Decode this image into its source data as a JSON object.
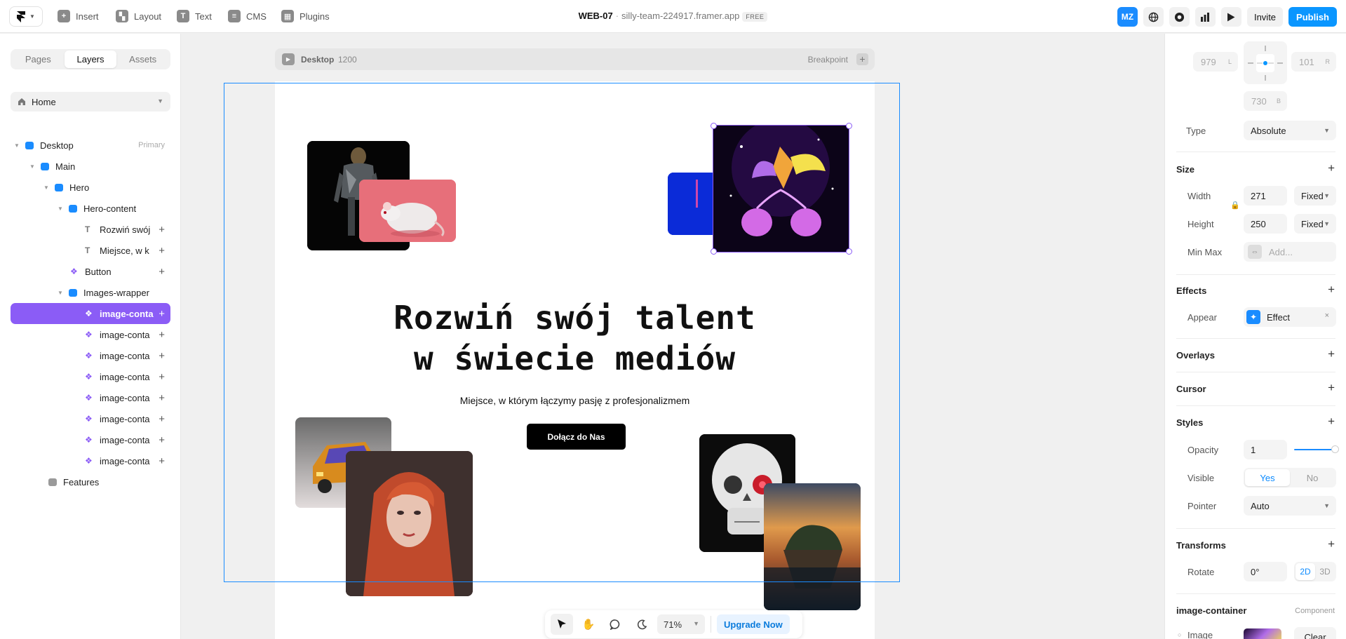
{
  "toolbar": {
    "insert": "Insert",
    "layout": "Layout",
    "text": "Text",
    "cms": "CMS",
    "plugins": "Plugins"
  },
  "project": {
    "name": "WEB-07",
    "separator": "·",
    "url": "silly-team-224917.framer.app",
    "plan": "FREE"
  },
  "topright": {
    "avatar": "MZ",
    "invite": "Invite",
    "publish": "Publish"
  },
  "left_panel": {
    "tabs": [
      "Pages",
      "Layers",
      "Assets"
    ],
    "active_tab": "Layers",
    "page": "Home",
    "layers": [
      {
        "label": "Desktop",
        "tag": "Primary"
      },
      {
        "label": "Main"
      },
      {
        "label": "Hero"
      },
      {
        "label": "Hero-content"
      },
      {
        "label": "Rozwiń swój"
      },
      {
        "label": "Miejsce, w k"
      },
      {
        "label": "Button"
      },
      {
        "label": "Images-wrapper"
      },
      {
        "label": "image-conta"
      },
      {
        "label": "image-conta"
      },
      {
        "label": "image-conta"
      },
      {
        "label": "image-conta"
      },
      {
        "label": "image-conta"
      },
      {
        "label": "image-conta"
      },
      {
        "label": "image-conta"
      },
      {
        "label": "image-conta"
      },
      {
        "label": "Features"
      }
    ]
  },
  "canvas": {
    "breakpoint_name": "Desktop",
    "breakpoint_width": "1200",
    "breakpoint_label": "Breakpoint",
    "hero_title_line1": "Rozwiń swój talent",
    "hero_title_line2": "w świecie mediów",
    "hero_subtitle": "Miejsce, w którym łączymy pasję z profesjonalizmem",
    "cta": "Dołącz do Nas",
    "zoom": "71%",
    "upgrade": "Upgrade Now"
  },
  "right_panel": {
    "pos_left": "979",
    "pos_left_suffix": "L",
    "pos_right": "101",
    "pos_right_suffix": "R",
    "pos_bottom": "730",
    "pos_bottom_suffix": "B",
    "type_label": "Type",
    "type_value": "Absolute",
    "size_title": "Size",
    "width_label": "Width",
    "width_value": "271",
    "width_mode": "Fixed",
    "height_label": "Height",
    "height_value": "250",
    "height_mode": "Fixed",
    "minmax_label": "Min Max",
    "minmax_placeholder": "Add...",
    "effects_title": "Effects",
    "appear_label": "Appear",
    "appear_value": "Effect",
    "overlays_title": "Overlays",
    "cursor_title": "Cursor",
    "styles_title": "Styles",
    "opacity_label": "Opacity",
    "opacity_value": "1",
    "visible_label": "Visible",
    "visible_yes": "Yes",
    "visible_no": "No",
    "pointer_label": "Pointer",
    "pointer_value": "Auto",
    "transforms_title": "Transforms",
    "rotate_label": "Rotate",
    "rotate_value": "0°",
    "mode_2d": "2D",
    "mode_3d": "3D",
    "component_name": "image-container",
    "component_tag": "Component",
    "image_label": "Image",
    "clear_label": "Clear"
  },
  "colors": {
    "accent_blue": "#0a96ff",
    "selection_purple": "#8b5cf6"
  }
}
